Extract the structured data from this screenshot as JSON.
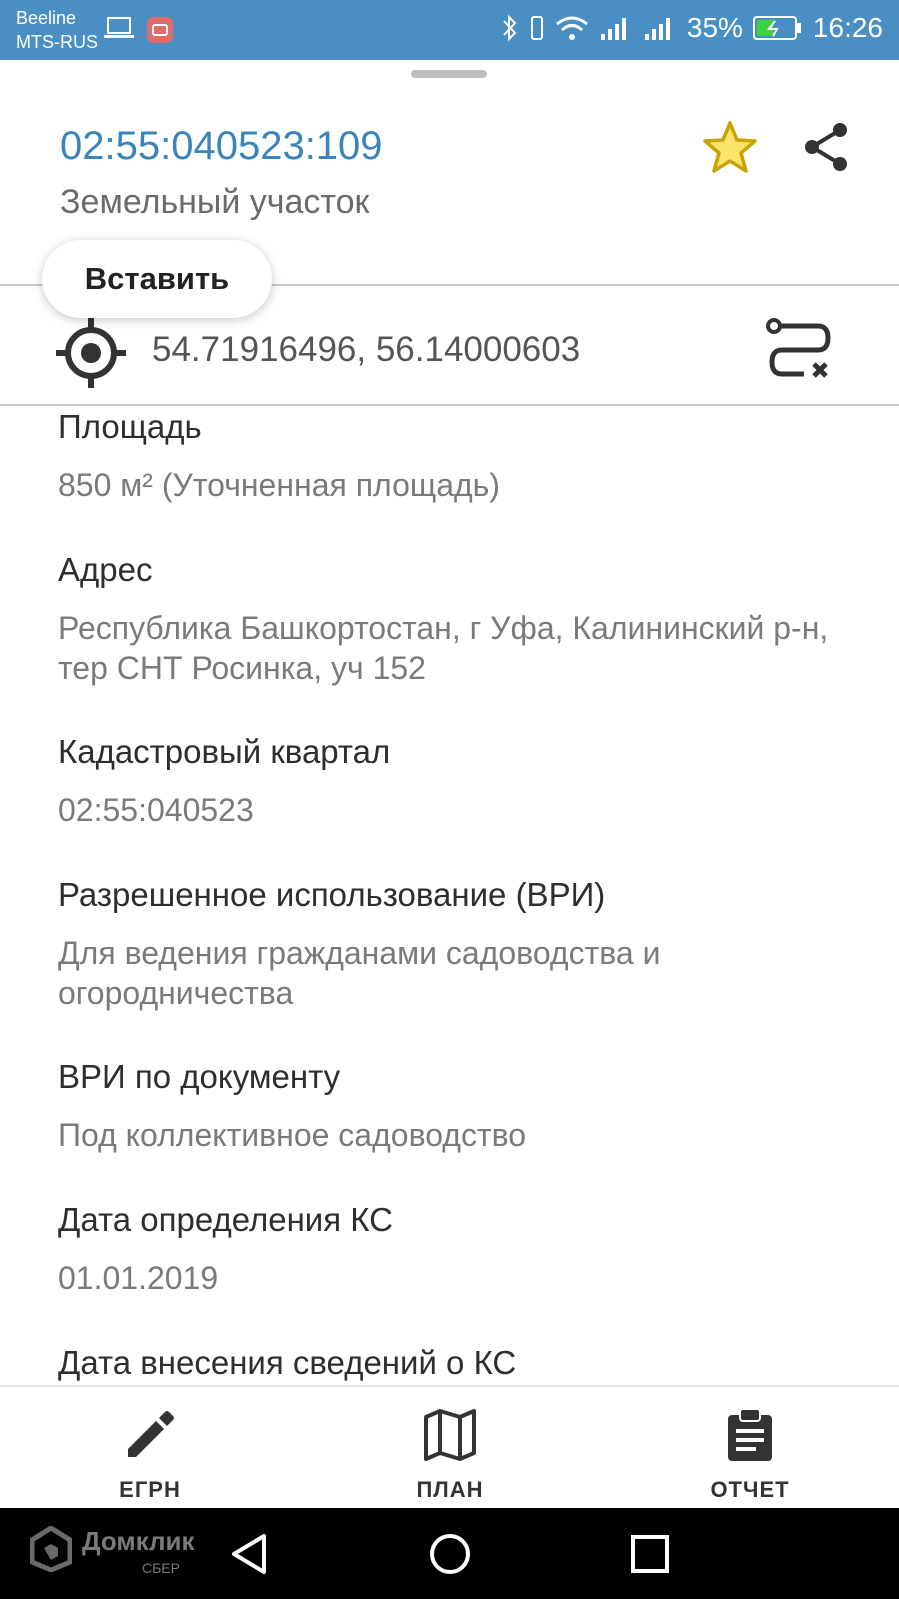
{
  "status_bar": {
    "carrier_1": "Beeline",
    "carrier_2": "MTS-RUS",
    "battery": "35%",
    "time": "16:26"
  },
  "header": {
    "cadastral_number": "02:55:040523:109",
    "parcel_type": "Земельный участок",
    "favorite_icon": "star-icon",
    "share_icon": "share-icon",
    "accent_color": "#3b84ba",
    "star_color": "#c9a400"
  },
  "context_menu": {
    "paste_label": "Вставить"
  },
  "location": {
    "coordinates": "54.71916496, 56.14000603",
    "gps_icon": "gps-target-icon",
    "route_icon": "route-clear-icon"
  },
  "fields": [
    {
      "label": "Площадь",
      "value": "850 м² (Уточненная площадь)"
    },
    {
      "label": "Адрес",
      "value": "Республика Башкортостан, г Уфа, Калининский р-н, тер СНТ Росинка, уч 152"
    },
    {
      "label": "Кадастровый квартал",
      "value": "02:55:040523"
    },
    {
      "label": "Разрешенное использование (ВРИ)",
      "value": "Для ведения гражданами садоводства и огородничества"
    },
    {
      "label": "ВРИ по документу",
      "value": "Под коллективное садоводство"
    },
    {
      "label": "Дата определения КС",
      "value": "01.01.2019"
    },
    {
      "label": "Дата внесения сведений о КС",
      "value": ""
    }
  ],
  "bottom_nav": {
    "items": [
      {
        "label": "ЕГРН",
        "icon": "pencil-icon"
      },
      {
        "label": "ПЛАН",
        "icon": "map-icon"
      },
      {
        "label": "ОТЧЕТ",
        "icon": "clipboard-icon"
      }
    ]
  },
  "system_nav": {
    "watermark": "Домклик",
    "watermark_sub": "СБЕР"
  }
}
